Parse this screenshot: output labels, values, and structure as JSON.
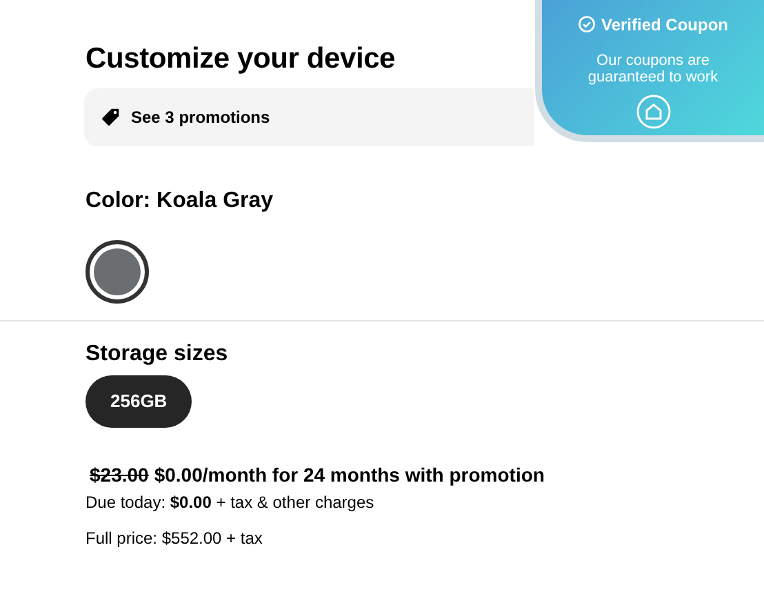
{
  "title": "Customize your device",
  "promotions": {
    "label": "See 3 promotions"
  },
  "color": {
    "label": "Color: Koala Gray",
    "swatches": [
      {
        "color": "#6b6e70",
        "selected": true
      }
    ]
  },
  "storage": {
    "label": "Storage sizes",
    "options": [
      {
        "label": "256GB",
        "selected": true
      }
    ]
  },
  "price": {
    "old": "$23.00",
    "new": "$0.00/month for 24 months with promotion",
    "due": "Due today: **$0.00** + tax & other charges",
    "full": "Full price: $552.00 + tax"
  },
  "coupon": {
    "title": "Verified Coupon",
    "text": "Our coupons are guaranteed to work"
  }
}
